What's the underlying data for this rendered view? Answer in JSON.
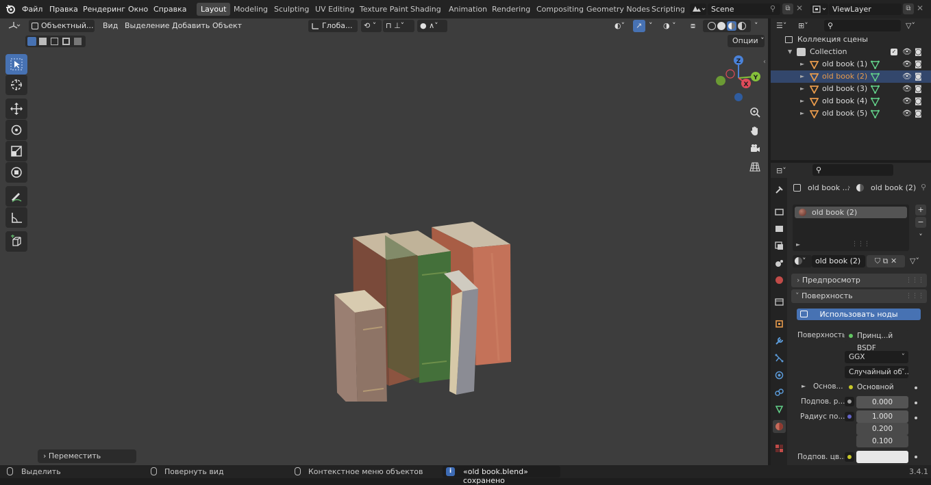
{
  "menu": {
    "file": "Файл",
    "edit": "Правка",
    "render": "Рендеринг",
    "window": "Окно",
    "help": "Справка"
  },
  "workspaces": [
    "Layout",
    "Modeling",
    "Sculpting",
    "UV Editing",
    "Texture Paint",
    "Shading",
    "Animation",
    "Rendering",
    "Compositing",
    "Geometry Nodes",
    "Scripting"
  ],
  "scene": {
    "name": "Scene",
    "view_layer": "ViewLayer"
  },
  "viewport": {
    "mode": "Объектный...",
    "menu_view": "Вид",
    "menu_select": "Выделение",
    "menu_add": "Добавить",
    "menu_object": "Объект",
    "orientation": "Глоба...",
    "options": "Опции",
    "last_op": "Переместить"
  },
  "gizmo": {
    "z": "Z",
    "y": "Y",
    "x": "X"
  },
  "outliner": {
    "scene_collection": "Коллекция сцены",
    "collection": "Collection",
    "objects": [
      "old book (1)",
      "old book (2)",
      "old book (3)",
      "old book (4)",
      "old book (5)"
    ],
    "selected_index": 1
  },
  "properties": {
    "breadcrumb_obj": "old book ...",
    "breadcrumb_mat": "old book (2)",
    "slot": "old book (2)",
    "material": "old book (2)",
    "preview": "Предпросмотр",
    "surface_panel": "Поверхность",
    "use_nodes": "Использовать ноды",
    "surface_label": "Поверхность",
    "surface_value": "Принц...й BSDF",
    "distribution": "GGX",
    "subsurface_method": "Случайный об...",
    "base_label": "Основ...",
    "base_value": "Основной цвет",
    "ss_label": "Подпов. р...",
    "ss_value": "0.000",
    "radius_label": "Радиус по...",
    "radius_values": [
      "1.000",
      "0.200",
      "0.100"
    ],
    "sscolor_label": "Подпов. цв..."
  },
  "status": {
    "select": "Выделить",
    "rotate": "Повернуть вид",
    "context": "Контекстное меню объектов",
    "saved": "«old book.blend» сохранено",
    "version": "3.4.1"
  },
  "colors": {
    "accent": "#4772b3",
    "selected_row": "#33476c",
    "object_icon": "#e89b4c",
    "mesh_icon": "#63d28a",
    "axis_x": "#e14b5a",
    "axis_y": "#86c13a",
    "axis_z": "#4a82d9"
  }
}
